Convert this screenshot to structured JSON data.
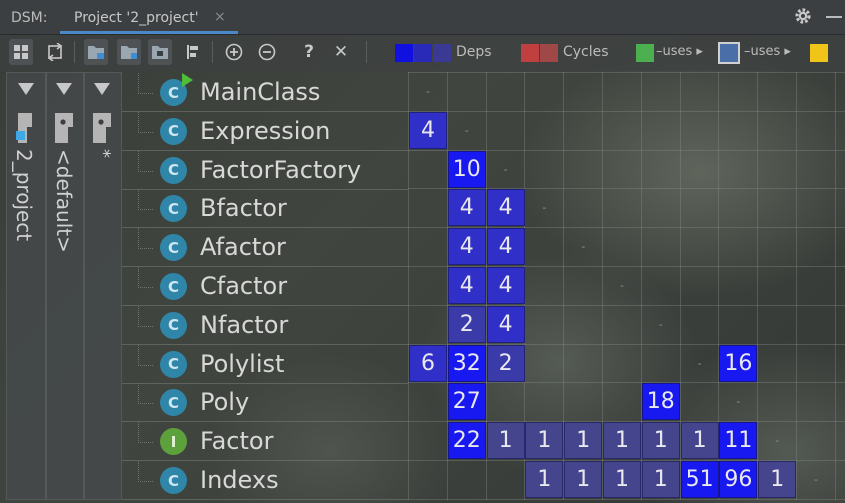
{
  "tabbar": {
    "dsm_label": "DSM:",
    "tab_label": "Project '2_project'",
    "close_glyph": "×"
  },
  "toolbar": {
    "help_glyph": "?",
    "close_glyph": "✕",
    "plus_glyph": "+",
    "minus_glyph": "−"
  },
  "legend": {
    "deps_label": "Deps",
    "cycles_label": "Cycles",
    "uses1_label": "–uses ▸",
    "uses2_label": "–uses ▸",
    "colors": {
      "deps": [
        "#1010e0",
        "#2a2ab8",
        "#3a3a95"
      ],
      "cycles": [
        "#c04040",
        "#a04848"
      ],
      "green": "#4caf50",
      "blue_box": "#4a6fa8",
      "yellow": "#f0c419"
    }
  },
  "hierarchy": {
    "project_label": "2_project",
    "default_label": "<default>",
    "star_label": "*"
  },
  "rows": [
    {
      "name": "MainClass",
      "kind": "C",
      "type": "class",
      "run": true
    },
    {
      "name": "Expression",
      "kind": "C",
      "type": "class"
    },
    {
      "name": "FactorFactory",
      "kind": "C",
      "type": "class"
    },
    {
      "name": "Bfactor",
      "kind": "C",
      "type": "class"
    },
    {
      "name": "Afactor",
      "kind": "C",
      "type": "class"
    },
    {
      "name": "Cfactor",
      "kind": "C",
      "type": "class"
    },
    {
      "name": "Nfactor",
      "kind": "C",
      "type": "class"
    },
    {
      "name": "Polylist",
      "kind": "C",
      "type": "class"
    },
    {
      "name": "Poly",
      "kind": "C",
      "type": "class"
    },
    {
      "name": "Factor",
      "kind": "I",
      "type": "interface"
    },
    {
      "name": "Indexs",
      "kind": "C",
      "type": "class"
    }
  ],
  "matrix": [
    [
      "-",
      "",
      "",
      "",
      "",
      "",
      "",
      "",
      "",
      "",
      ""
    ],
    [
      "4",
      "-",
      "",
      "",
      "",
      "",
      "",
      "",
      "",
      "",
      ""
    ],
    [
      "",
      "10",
      "-",
      "",
      "",
      "",
      "",
      "",
      "",
      "",
      ""
    ],
    [
      "",
      "4",
      "4",
      "-",
      "",
      "",
      "",
      "",
      "",
      "",
      ""
    ],
    [
      "",
      "4",
      "4",
      "",
      "-",
      "",
      "",
      "",
      "",
      "",
      ""
    ],
    [
      "",
      "4",
      "4",
      "",
      "",
      "-",
      "",
      "",
      "",
      "",
      ""
    ],
    [
      "",
      "2",
      "4",
      "",
      "",
      "",
      "-",
      "",
      "",
      "",
      ""
    ],
    [
      "6",
      "32",
      "2",
      "",
      "",
      "",
      "",
      "-",
      "16",
      "",
      ""
    ],
    [
      "",
      "27",
      "",
      "",
      "",
      "",
      "18",
      "",
      "-",
      "",
      ""
    ],
    [
      "",
      "22",
      "1",
      "1",
      "1",
      "1",
      "1",
      "1",
      "11",
      "-",
      ""
    ],
    [
      "",
      "",
      "",
      "1",
      "1",
      "1",
      "1",
      "51",
      "96",
      "1",
      "-"
    ]
  ]
}
